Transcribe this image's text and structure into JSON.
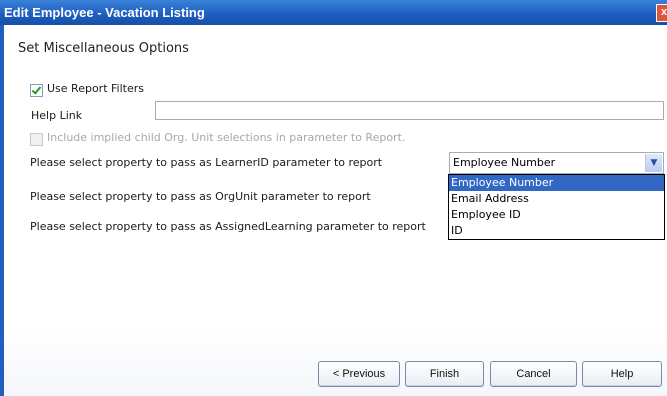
{
  "window": {
    "title": "Edit Employee - Vacation Listing",
    "close_glyph": "x"
  },
  "section": {
    "heading": "Set Miscellaneous Options"
  },
  "options": {
    "use_report_filters": {
      "label": "Use Report Filters",
      "checked": true
    },
    "help_link": {
      "label": "Help Link",
      "value": ""
    },
    "include_implied": {
      "label": "Include implied child Org. Unit selections in parameter to Report.",
      "checked": false,
      "disabled": true
    },
    "learner_id": {
      "label": "Please select property to pass as LearnerID parameter to report",
      "selected": "Employee Number"
    },
    "org_unit": {
      "label": "Please select property to pass as OrgUnit parameter to report"
    },
    "assigned_learning": {
      "label": "Please select property to pass as AssignedLearning parameter to report"
    }
  },
  "dropdown": {
    "options": [
      "Employee Number",
      "Email Address",
      "Employee ID",
      "ID"
    ],
    "highlighted": "Employee Number"
  },
  "buttons": {
    "previous": "< Previous",
    "finish": "Finish",
    "cancel": "Cancel",
    "help": "Help"
  },
  "icons": {
    "check": "check-icon",
    "dropdown_arrow": "chevron-down-icon",
    "close": "close-icon"
  },
  "colors": {
    "titlebar": "#1f5fc0",
    "selection": "#3168c6"
  }
}
